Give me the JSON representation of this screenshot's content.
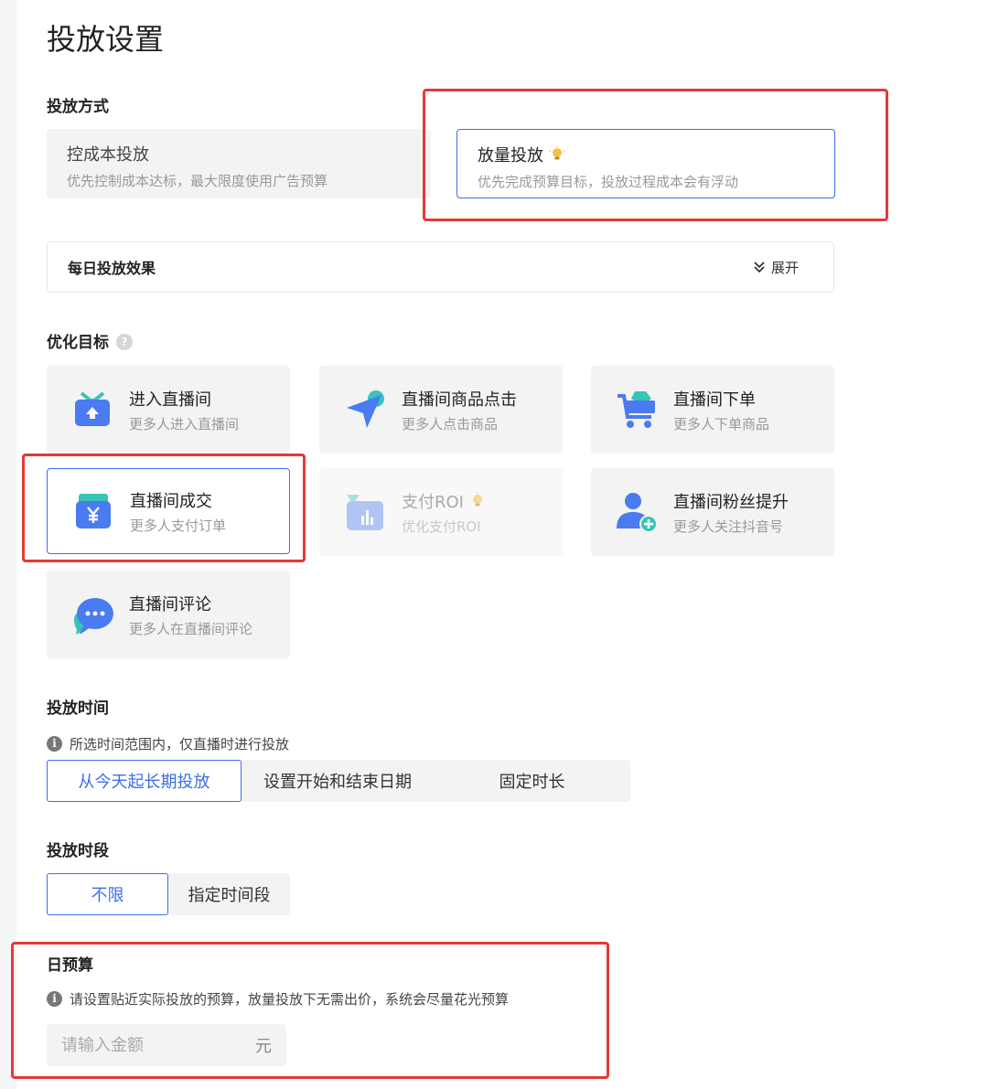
{
  "page": {
    "title": "投放设置"
  },
  "delivery_mode": {
    "label": "投放方式",
    "options": [
      {
        "title": "控成本投放",
        "subtitle": "优先控制成本达标，最大限度使用广告预算"
      },
      {
        "title": "放量投放",
        "subtitle": "优先完成预算目标，投放过程成本会有浮动"
      }
    ],
    "selected": "放量投放"
  },
  "daily_effect": {
    "label": "每日投放效果",
    "expand_label": "展开"
  },
  "goal": {
    "label": "优化目标",
    "help_icon": "help-icon",
    "options": [
      {
        "title": "进入直播间",
        "subtitle": "更多人进入直播间",
        "icon": "tv-enter-icon"
      },
      {
        "title": "直播间商品点击",
        "subtitle": "更多人点击商品",
        "icon": "cursor-click-icon"
      },
      {
        "title": "直播间下单",
        "subtitle": "更多人下单商品",
        "icon": "cart-icon"
      },
      {
        "title": "直播间成交",
        "subtitle": "更多人支付订单",
        "icon": "yuan-wallet-icon"
      },
      {
        "title": "支付ROI",
        "subtitle": "优化支付ROI",
        "icon": "roi-chart-icon"
      },
      {
        "title": "直播间粉丝提升",
        "subtitle": "更多人关注抖音号",
        "icon": "user-add-icon"
      },
      {
        "title": "直播间评论",
        "subtitle": "更多人在直播间评论",
        "icon": "chat-bubble-icon"
      }
    ],
    "selected": "直播间成交",
    "disabled": [
      "支付ROI"
    ]
  },
  "schedule": {
    "label": "投放时间",
    "note": "所选时间范围内，仅直播时进行投放",
    "options": [
      "从今天起长期投放",
      "设置开始和结束日期",
      "固定时长"
    ],
    "selected": "从今天起长期投放"
  },
  "time_slot": {
    "label": "投放时段",
    "options": [
      "不限",
      "指定时间段"
    ],
    "selected": "不限"
  },
  "budget": {
    "label": "日预算",
    "note": "请设置贴近实际投放的预算，放量投放下无需出价，系统会尽量花光预算",
    "placeholder": "请输入金额",
    "unit": "元"
  },
  "colors": {
    "accent": "#3e6ee8",
    "highlight": "#e53935",
    "card_bg": "#f3f3f3"
  }
}
